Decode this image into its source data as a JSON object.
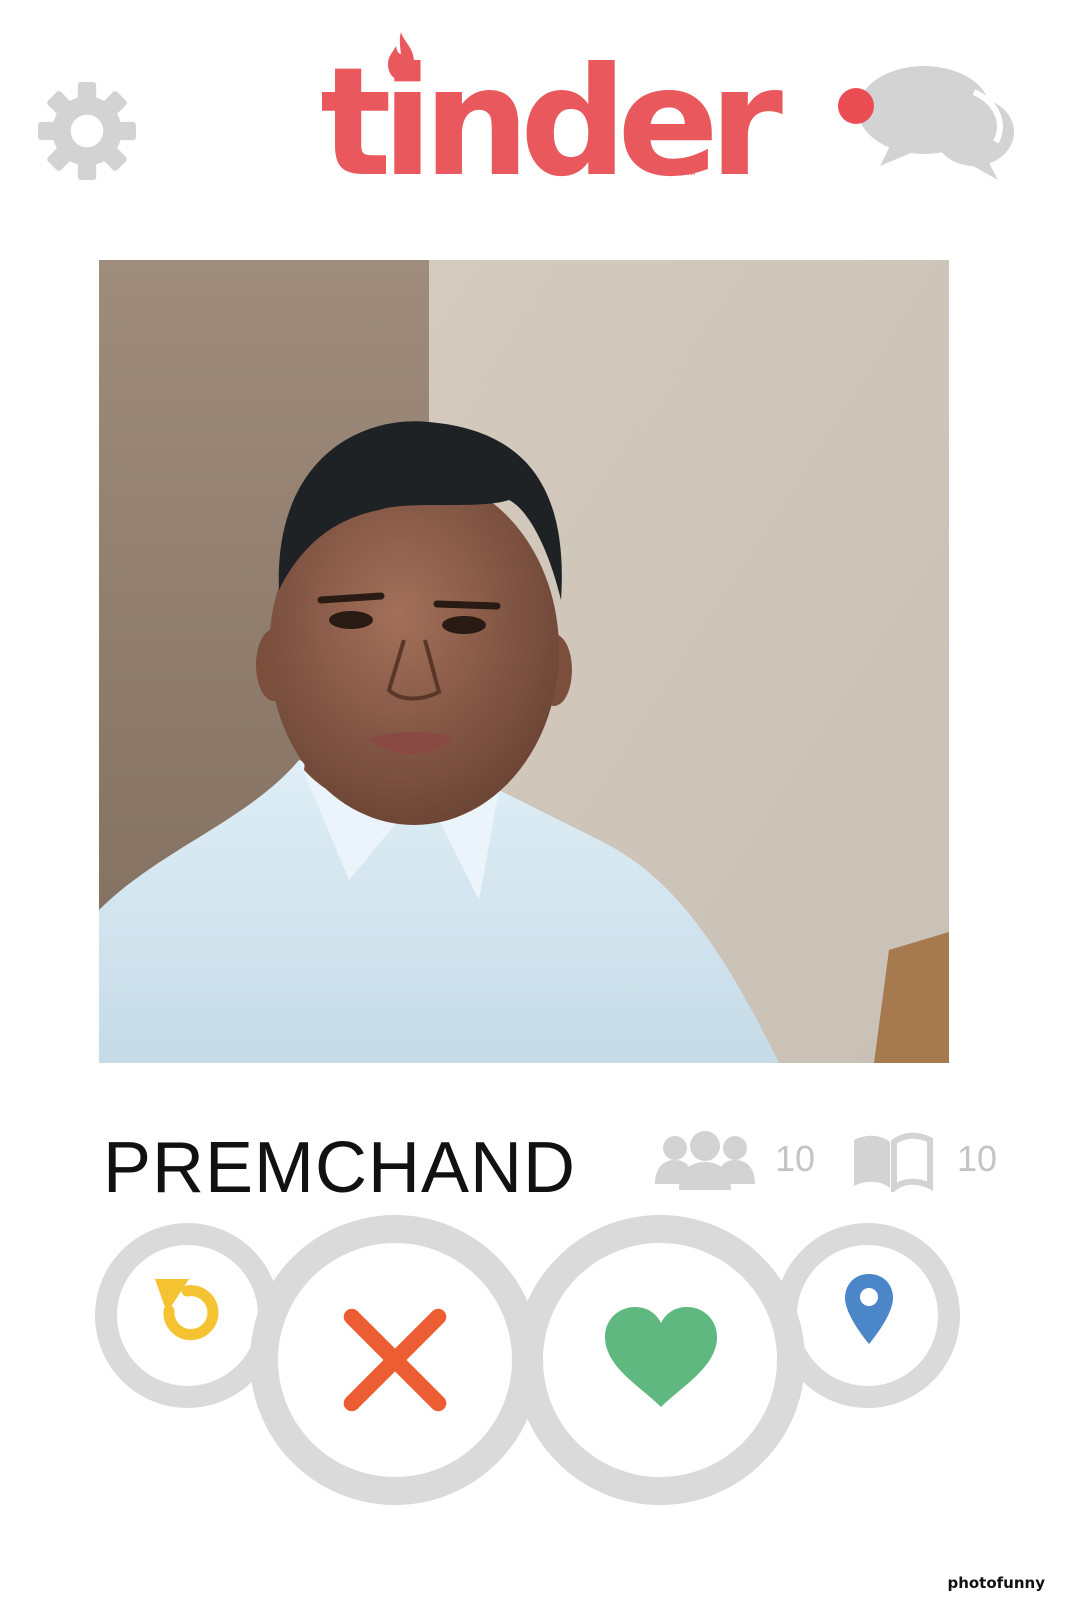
{
  "header": {
    "logo_text": "tinder",
    "logo_tm": "™",
    "logo_color": "#e8585c",
    "settings_icon": "gear-icon",
    "messages_icon": "chat-bubbles-icon",
    "notification_dot_color": "#ea4d54",
    "icon_color": "#d3d3d3"
  },
  "profile": {
    "name": "PREMCHAND",
    "friends_icon": "group-icon",
    "friends_count": "10",
    "interests_icon": "open-book-icon",
    "interests_count": "10",
    "photo_subject": "profile-photo"
  },
  "actions": {
    "undo": {
      "icon": "undo-arrow-icon",
      "color": "#f5c331"
    },
    "nope": {
      "icon": "x-icon",
      "color": "#ec5d34"
    },
    "like": {
      "icon": "heart-icon",
      "color": "#5fb87f"
    },
    "location": {
      "icon": "map-pin-icon",
      "color": "#4a86c8"
    },
    "ring_color": "#dadada"
  },
  "watermark": "photofunny"
}
